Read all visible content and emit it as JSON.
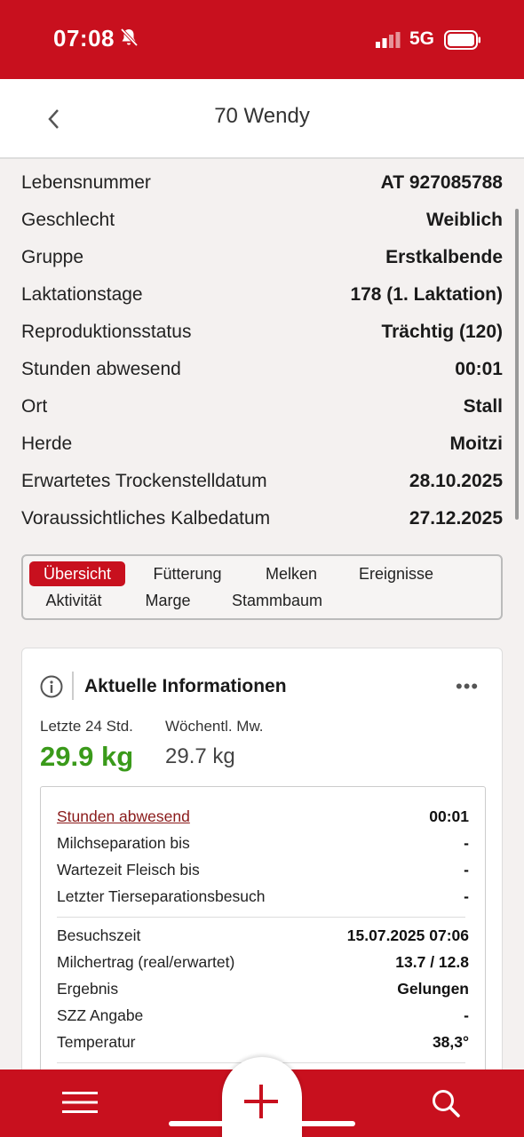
{
  "status_bar": {
    "time": "07:08",
    "network": "5G"
  },
  "nav": {
    "title": "70 Wendy"
  },
  "info_rows": [
    {
      "label": "Lebensnummer",
      "value": "AT 927085788"
    },
    {
      "label": "Geschlecht",
      "value": "Weiblich"
    },
    {
      "label": "Gruppe",
      "value": "Erstkalbende"
    },
    {
      "label": "Laktationstage",
      "value": "178 (1. Laktation)"
    },
    {
      "label": "Reproduktionsstatus",
      "value": "Trächtig (120)"
    },
    {
      "label": "Stunden abwesend",
      "value": "00:01"
    },
    {
      "label": "Ort",
      "value": "Stall"
    },
    {
      "label": "Herde",
      "value": "Moitzi"
    },
    {
      "label": "Erwartetes Trockenstelldatum",
      "value": "28.10.2025"
    },
    {
      "label": "Voraussichtliches Kalbedatum",
      "value": "27.12.2025"
    }
  ],
  "tabs": [
    {
      "label": "Übersicht",
      "active": true
    },
    {
      "label": "Fütterung"
    },
    {
      "label": "Melken"
    },
    {
      "label": "Ereignisse"
    },
    {
      "label": "Aktivität"
    },
    {
      "label": "Marge"
    },
    {
      "label": "Stammbaum"
    }
  ],
  "card": {
    "title": "Aktuelle Informationen",
    "more": "•••",
    "last24_label": "Letzte 24 Std.",
    "last24_value": "29.9 kg",
    "weekly_label": "Wöchentl. Mw.",
    "weekly_value": "29.7 kg",
    "rows_a": [
      {
        "label": "Stunden abwesend",
        "value": "00:01",
        "link": true
      },
      {
        "label": "Milchseparation bis",
        "value": "-"
      },
      {
        "label": "Wartezeit Fleisch bis",
        "value": "-"
      },
      {
        "label": "Letzter Tierseparationsbesuch",
        "value": "-"
      }
    ],
    "rows_b": [
      {
        "label": "Besuchszeit",
        "value": "15.07.2025 07:06"
      },
      {
        "label": "Milchertrag (real/erwartet)",
        "value": "13.7 / 12.8"
      },
      {
        "label": "Ergebnis",
        "value": "Gelungen"
      },
      {
        "label": "SZZ Angabe",
        "value": "-"
      },
      {
        "label": "Temperatur",
        "value": "38,3°"
      }
    ]
  },
  "colors": {
    "brand": "#c8101e",
    "positive": "#3a9a1a"
  },
  "icons": {
    "back": "chevron-left-icon",
    "info": "info-icon",
    "menu": "hamburger-menu-icon",
    "add": "plus-icon",
    "search": "search-icon"
  }
}
